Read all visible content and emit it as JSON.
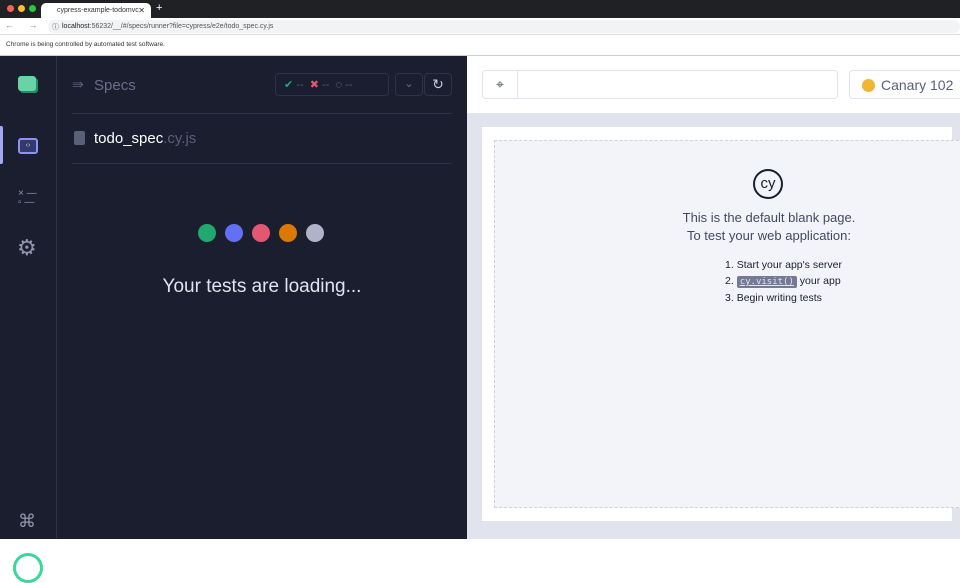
{
  "browser": {
    "tab_title": "cypress-example-todomvc",
    "new_tab": "+",
    "tab_close": "✕",
    "url_host": "localhost",
    "url_rest": ":56232/__/#/specs/runner?file=cypress/e2e/todo_spec.cy.js",
    "info_bar": "Chrome is being controlled by automated test software.",
    "nav": "← → ✕",
    "info_icon": "ⓘ"
  },
  "specs": {
    "title": "Specs",
    "passed": "--",
    "failed": "--",
    "pending": "--",
    "spec_name": "todo_spec",
    "spec_ext": ".cy.js",
    "loading": "Your tests are loading...",
    "dot_colors": [
      "#1fa971",
      "#6470f3",
      "#e45770",
      "#db7903",
      "#afb3c7"
    ]
  },
  "runner": {
    "url_value": "",
    "browser_label": "Canary 102"
  },
  "blank": {
    "line1": "This is the default blank page.",
    "line2": "To test your web application:",
    "steps": [
      {
        "num": "1.",
        "text": "Start your app's server"
      },
      {
        "num": "2.",
        "code": "cy.visit()",
        "text": " your app"
      },
      {
        "num": "3.",
        "text": "Begin writing tests"
      }
    ],
    "logo": "cy"
  }
}
